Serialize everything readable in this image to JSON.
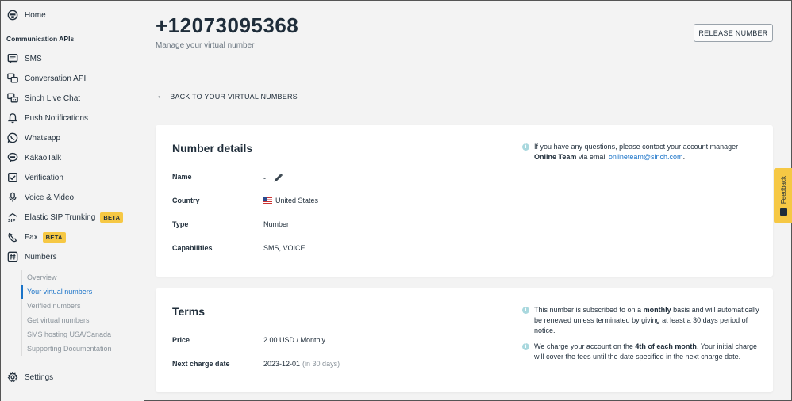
{
  "sidebar": {
    "home": "Home",
    "section_title": "Communication APIs",
    "items": [
      {
        "label": "SMS",
        "icon": "sms-icon"
      },
      {
        "label": "Conversation API",
        "icon": "conversation-icon"
      },
      {
        "label": "Sinch Live Chat",
        "icon": "live-chat-icon"
      },
      {
        "label": "Push Notifications",
        "icon": "bell-icon"
      },
      {
        "label": "Whatsapp",
        "icon": "whatsapp-icon"
      },
      {
        "label": "KakaoTalk",
        "icon": "kakaotalk-icon"
      },
      {
        "label": "Verification",
        "icon": "checkbox-icon"
      },
      {
        "label": "Voice & Video",
        "icon": "microphone-icon"
      },
      {
        "label": "Elastic SIP Trunking",
        "icon": "sip-icon",
        "badge": "BETA"
      },
      {
        "label": "Fax",
        "icon": "fax-icon",
        "badge": "BETA"
      },
      {
        "label": "Numbers",
        "icon": "hash-icon"
      }
    ],
    "sub_items": [
      {
        "label": "Overview",
        "active": false
      },
      {
        "label": "Your virtual numbers",
        "active": true
      },
      {
        "label": "Verified numbers",
        "active": false
      },
      {
        "label": "Get virtual numbers",
        "active": false
      },
      {
        "label": "SMS hosting USA/Canada",
        "active": false
      },
      {
        "label": "Supporting Documentation",
        "active": false
      }
    ],
    "settings": "Settings"
  },
  "header": {
    "number": "+12073095368",
    "subtitle": "Manage your virtual number",
    "release_button": "RELEASE NUMBER",
    "back_link": "BACK TO YOUR VIRTUAL NUMBERS"
  },
  "details": {
    "title": "Number details",
    "name_label": "Name",
    "name_value": "-",
    "country_label": "Country",
    "country_value": "United States",
    "type_label": "Type",
    "type_value": "Number",
    "capabilities_label": "Capabilities",
    "capabilities_value": "SMS, VOICE",
    "info_pre": "If you have any questions, please contact your account manager ",
    "info_manager": "Online Team",
    "info_mid": " via email ",
    "info_email": "onlineteam@sinch.com",
    "info_end": "."
  },
  "terms": {
    "title": "Terms",
    "price_label": "Price",
    "price_value": "2.00 USD / Monthly",
    "next_label": "Next charge date",
    "next_value": "2023-12-01",
    "next_hint": "(in 30 days)",
    "info1_pre": "This number is subscribed to on a ",
    "info1_bold": "monthly",
    "info1_post": " basis and will automatically be renewed unless terminated by giving at least a 30 days period of notice.",
    "info2_pre": "We charge your account on the ",
    "info2_bold": "4th of each month",
    "info2_post": ". Your initial charge will cover the fees until the date specified in the next charge date."
  },
  "feedback": {
    "label": "Feedback"
  },
  "colors": {
    "accent": "#1a73c8",
    "badge": "#f6c844",
    "info_dot": "#a9d8de"
  }
}
